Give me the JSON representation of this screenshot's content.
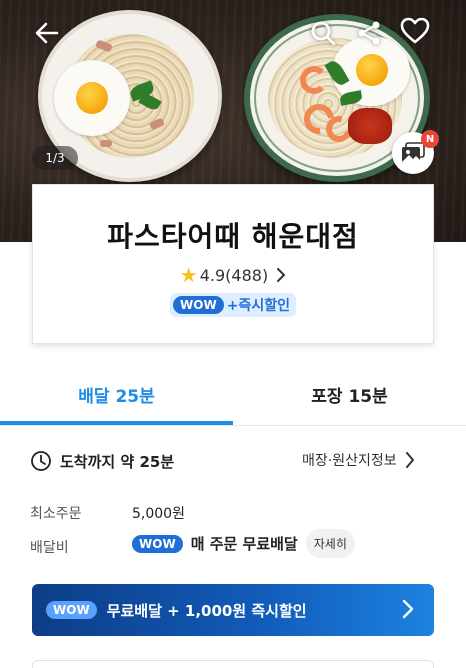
{
  "hero": {
    "image_counter": "1/3",
    "new_badge": "N"
  },
  "store": {
    "name": "파스타어때 해운대점",
    "rating": "4.9(488)",
    "wow_tag": "WOW",
    "wow_promo": "+즉시할인"
  },
  "tabs": [
    {
      "label": "배달 25분",
      "active": true
    },
    {
      "label": "포장 15분",
      "active": false
    }
  ],
  "info": {
    "arrival": "도착까지 약 25분",
    "origin_link": "매장·원산지정보",
    "min_order_label": "최소주문",
    "min_order_value": "5,000원",
    "delivery_fee_label": "배달비",
    "fee_wow_tag": "WOW",
    "fee_text": "매 주문 무료배달",
    "detail_button": "자세히"
  },
  "promo": {
    "wow_tag": "WOW",
    "text": "무료배달 + 1,000원 즉시할인"
  },
  "colors": {
    "accent": "#1f8ce6",
    "wow_blue": "#1f6fd6",
    "promo_dark": "#0d3d86",
    "star": "#f7c01a",
    "badge_red": "#e9463a"
  }
}
